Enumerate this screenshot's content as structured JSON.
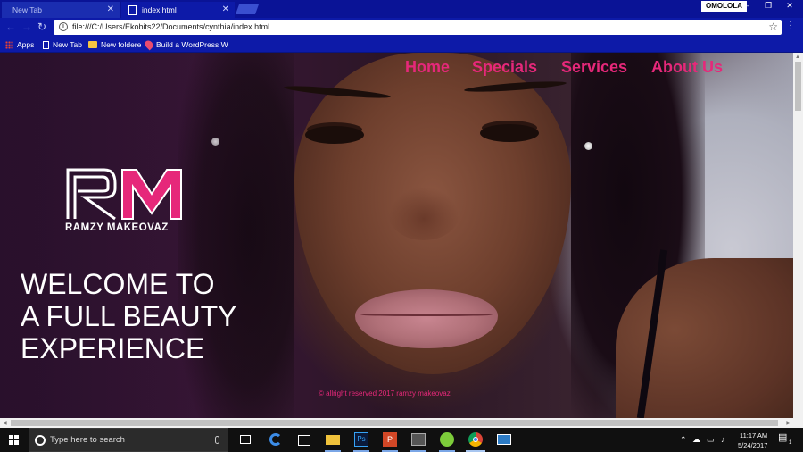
{
  "browser": {
    "tabs": [
      {
        "label": "New Tab",
        "active": false
      },
      {
        "label": "index.html",
        "active": true
      }
    ],
    "address": "file:///C:/Users/Ekobits22/Documents/cynthia/index.html",
    "window_user": "OMOLOLA",
    "bookmarks": [
      "Apps",
      "New Tab",
      "New foldere",
      "Build a WordPress W"
    ]
  },
  "page": {
    "nav": [
      "Home",
      "Specials",
      "Services",
      "About Us"
    ],
    "logo_tagline": "RAMZY MAKEOVAZ",
    "logo_letters": "RM",
    "headline_lines": [
      "WELCOME TO",
      "A FULL BEAUTY",
      "EXPERIENCE"
    ],
    "footer": "© allright reserved 2017 ramzy makeovaz"
  },
  "taskbar": {
    "search_placeholder": "Type here to search",
    "time": "11:17 AM",
    "date": "5/24/2017",
    "notification_count": "1"
  },
  "colors": {
    "accent_pink": "#e6287a",
    "chrome_blue": "#0d1aa8",
    "taskbar": "#101010"
  }
}
